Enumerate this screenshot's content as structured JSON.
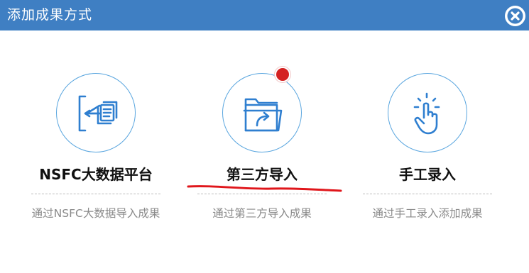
{
  "dialog": {
    "title": "添加成果方式",
    "close_icon": "close-circle-icon"
  },
  "colors": {
    "header_bg": "#3f7fc3",
    "icon_blue": "#2f7fd0",
    "circle_border": "#5aa6df",
    "badge_red": "#d42121",
    "underline_red": "#e0161b",
    "desc_gray": "#8a8a8a"
  },
  "options": [
    {
      "icon": "import-data-icon",
      "title": "NSFC大数据平台",
      "description": "通过NSFC大数据导入成果"
    },
    {
      "icon": "folder-share-icon",
      "title": "第三方导入",
      "description": "通过第三方导入成果",
      "has_badge": true
    },
    {
      "icon": "tap-hand-icon",
      "title": "手工录入",
      "description": "通过手工录入添加成果"
    }
  ]
}
